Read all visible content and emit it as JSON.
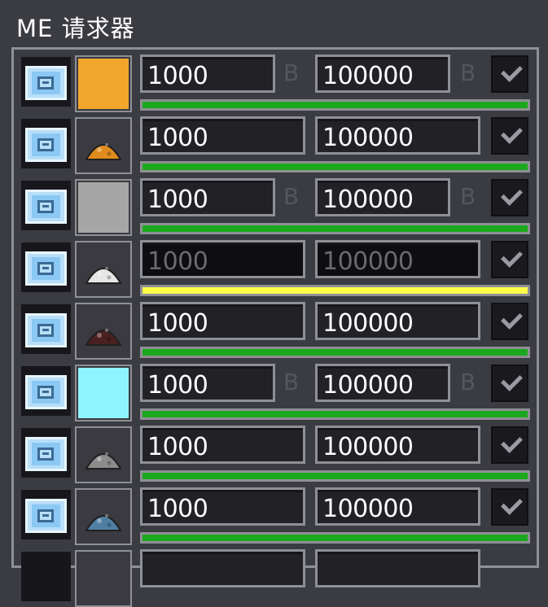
{
  "window": {
    "title": "ME 请求器"
  },
  "unit_label": "B",
  "check_icon": "check-icon",
  "rows": [
    {
      "item": "orange-block",
      "item_color": "#f2a62b",
      "min": "1000",
      "max": "100000",
      "unit": true,
      "enabled": true,
      "status": "ok"
    },
    {
      "item": "orange-dust",
      "item_color": "#e08b1e",
      "min": "1000",
      "max": "100000",
      "unit": false,
      "enabled": true,
      "status": "ok"
    },
    {
      "item": "gray-block",
      "item_color": "#a6a6a6",
      "min": "1000",
      "max": "100000",
      "unit": true,
      "enabled": true,
      "status": "ok"
    },
    {
      "item": "white-dust",
      "item_color": "#e6e6e6",
      "min": "1000",
      "max": "100000",
      "unit": false,
      "enabled": false,
      "status": "warning"
    },
    {
      "item": "dark-red-dust",
      "item_color": "#4a2020",
      "min": "1000",
      "max": "100000",
      "unit": false,
      "enabled": true,
      "status": "ok"
    },
    {
      "item": "cyan-block",
      "item_color": "#8ef4ff",
      "min": "1000",
      "max": "100000",
      "unit": true,
      "enabled": true,
      "status": "ok"
    },
    {
      "item": "gray-dust",
      "item_color": "#8c8c8c",
      "min": "1000",
      "max": "100000",
      "unit": false,
      "enabled": true,
      "status": "ok"
    },
    {
      "item": "blue-dust",
      "item_color": "#4f7fa3",
      "min": "1000",
      "max": "100000",
      "unit": false,
      "enabled": true,
      "status": "ok"
    }
  ],
  "colors": {
    "progress_ok": "#1ca81c",
    "progress_warning": "#ffff4a",
    "button_face": "#b8def8"
  }
}
